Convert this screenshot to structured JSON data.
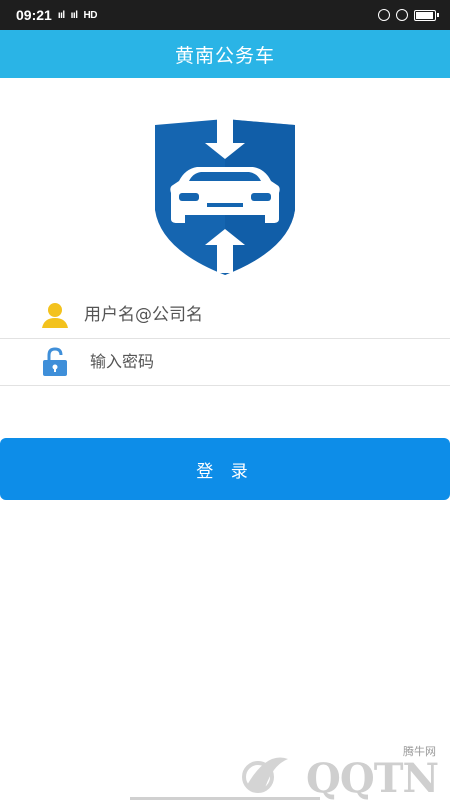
{
  "status_bar": {
    "time": "09:21",
    "signal1": "ııl",
    "signal2": "ııl",
    "network": "HD",
    "icons": [
      "lock-icon",
      "alarm-icon",
      "battery-icon"
    ]
  },
  "header": {
    "title": "黄南公务车"
  },
  "logo": {
    "name": "shield-car-logo",
    "colors": {
      "shield": "#1565b0",
      "car": "#ffffff"
    }
  },
  "form": {
    "username": {
      "placeholder": "用户名@公司名",
      "value": ""
    },
    "password": {
      "placeholder": "输入密码",
      "value": ""
    },
    "login_label": "登 录"
  },
  "watermark": {
    "site_text": "腾牛网",
    "logo_text": "QQTN"
  },
  "colors": {
    "title_bar": "#2ab4e6",
    "button": "#0d8de8",
    "user_icon": "#f3c21d",
    "lock_icon": "#3f8fd9"
  }
}
